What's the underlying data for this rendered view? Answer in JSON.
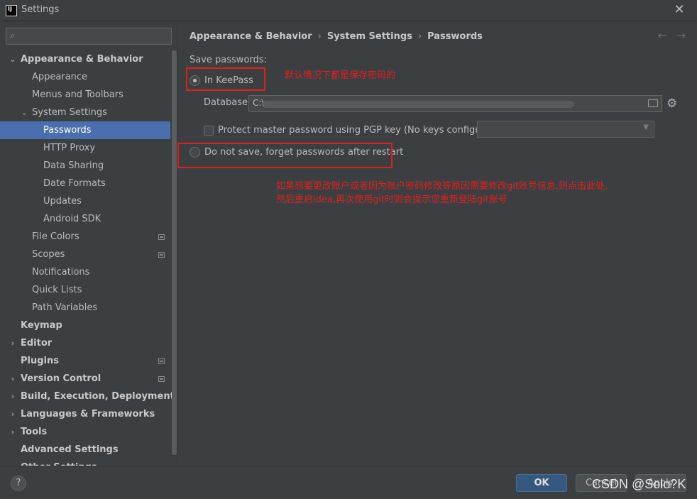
{
  "window": {
    "title": "Settings"
  },
  "search": {
    "placeholder": ""
  },
  "sidebar": {
    "items": [
      {
        "label": "Appearance & Behavior",
        "indent": 0,
        "expanded": true,
        "bold": true,
        "selected": false,
        "project": false
      },
      {
        "label": "Appearance",
        "indent": 1,
        "bold": false,
        "selected": false,
        "project": false
      },
      {
        "label": "Menus and Toolbars",
        "indent": 1,
        "bold": false,
        "selected": false,
        "project": false
      },
      {
        "label": "System Settings",
        "indent": 1,
        "expanded": true,
        "bold": false,
        "selected": false,
        "project": false
      },
      {
        "label": "Passwords",
        "indent": 2,
        "bold": false,
        "selected": true,
        "project": false
      },
      {
        "label": "HTTP Proxy",
        "indent": 2,
        "bold": false,
        "selected": false,
        "project": false
      },
      {
        "label": "Data Sharing",
        "indent": 2,
        "bold": false,
        "selected": false,
        "project": false
      },
      {
        "label": "Date Formats",
        "indent": 2,
        "bold": false,
        "selected": false,
        "project": false
      },
      {
        "label": "Updates",
        "indent": 2,
        "bold": false,
        "selected": false,
        "project": false
      },
      {
        "label": "Android SDK",
        "indent": 2,
        "bold": false,
        "selected": false,
        "project": false
      },
      {
        "label": "File Colors",
        "indent": 1,
        "bold": false,
        "selected": false,
        "project": true
      },
      {
        "label": "Scopes",
        "indent": 1,
        "bold": false,
        "selected": false,
        "project": true
      },
      {
        "label": "Notifications",
        "indent": 1,
        "bold": false,
        "selected": false,
        "project": false
      },
      {
        "label": "Quick Lists",
        "indent": 1,
        "bold": false,
        "selected": false,
        "project": false
      },
      {
        "label": "Path Variables",
        "indent": 1,
        "bold": false,
        "selected": false,
        "project": false
      },
      {
        "label": "Keymap",
        "indent": 0,
        "bold": true,
        "selected": false,
        "project": false
      },
      {
        "label": "Editor",
        "indent": 0,
        "expanded": false,
        "bold": true,
        "selected": false,
        "project": false
      },
      {
        "label": "Plugins",
        "indent": 0,
        "bold": true,
        "selected": false,
        "project": true
      },
      {
        "label": "Version Control",
        "indent": 0,
        "expanded": false,
        "bold": true,
        "selected": false,
        "project": true
      },
      {
        "label": "Build, Execution, Deployment",
        "indent": 0,
        "expanded": false,
        "bold": true,
        "selected": false,
        "project": false
      },
      {
        "label": "Languages & Frameworks",
        "indent": 0,
        "expanded": false,
        "bold": true,
        "selected": false,
        "project": false
      },
      {
        "label": "Tools",
        "indent": 0,
        "expanded": false,
        "bold": true,
        "selected": false,
        "project": false
      },
      {
        "label": "Advanced Settings",
        "indent": 0,
        "bold": true,
        "selected": false,
        "project": false
      },
      {
        "label": "Other Settings",
        "indent": 0,
        "expanded": false,
        "bold": true,
        "selected": false,
        "project": false
      }
    ]
  },
  "breadcrumb": {
    "part1": "Appearance & Behavior",
    "part2": "System Settings",
    "part3": "Passwords",
    "sep": "›"
  },
  "nav": {
    "back": "←",
    "forward": "→"
  },
  "passwords": {
    "save_label": "Save passwords:",
    "option_keepass": "In KeePass",
    "database_label": "Database:",
    "database_value": "C:\\",
    "protect_label": "Protect master password using PGP key (No keys configured)",
    "option_nosave": "Do not save, forget passwords after restart"
  },
  "annotations": {
    "note1": "默认情况下都是保存密码的",
    "note2_line1": "如果想要更改账户或者因为账户密码修改等原因需要修改git账号信息,则点击此处,",
    "note2_line2": "然后重启idea,再次使用git时则会提示您重新登陆git账号",
    "color": "#e02020"
  },
  "footer": {
    "help": "?",
    "ok": "OK",
    "cancel": "Cancel",
    "apply": "Apply",
    "watermark": "CSDN @Solo?K"
  },
  "colors": {
    "selection": "#4b6eaf",
    "background": "#3c3f41",
    "ok_button": "#365880"
  }
}
